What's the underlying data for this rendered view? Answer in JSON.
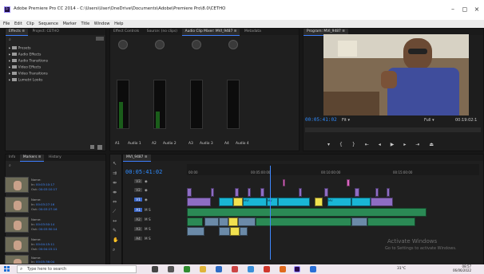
{
  "window": {
    "title": "Adobe Premiere Pro CC 2014 - C:\\Users\\User\\OneDrive\\Documents\\Adobe\\Premiere Pro\\8.0\\CETHO",
    "app_icon": "Pr",
    "minimize": "–",
    "maximize": "◻",
    "close": "×"
  },
  "menu": [
    "File",
    "Edit",
    "Clip",
    "Sequence",
    "Marker",
    "Title",
    "Window",
    "Help"
  ],
  "effects_panel": {
    "tabs": [
      "Effects ≡",
      "Project: CETHO"
    ],
    "items": [
      "Presets",
      "Audio Effects",
      "Audio Transitions",
      "Video Effects",
      "Video Transitions",
      "Lumetri Looks"
    ]
  },
  "mixer_panel": {
    "tabs": [
      "Effect Controls",
      "Source: (no clips)",
      "Audio Clip Mixer: MVI_9487 ≡",
      "Metadata"
    ],
    "tracks": [
      {
        "id": "A1",
        "name": "Audio 1",
        "level": 0.55
      },
      {
        "id": "A2",
        "name": "Audio 2",
        "level": 0.35
      },
      {
        "id": "A3",
        "name": "Audio 3",
        "level": 0.0
      },
      {
        "id": "A4",
        "name": "Audio 4",
        "level": 0.0
      }
    ],
    "scale": [
      "6",
      "-6",
      "-12",
      "-18",
      "-24",
      "-30",
      "-36",
      "-42",
      "-48",
      "dB"
    ]
  },
  "program_panel": {
    "tab": "Program: MVI_9487 ≡",
    "timecode": "00:05:41:02",
    "fit": "Fit",
    "quality": "Full",
    "duration": "00:19:02:1"
  },
  "project_panel": {
    "tabs": [
      "Info",
      "Markers ≡",
      "History"
    ],
    "clips": [
      {
        "name": "Name:",
        "in": "00:03:10:17",
        "out": "00:03:10:17"
      },
      {
        "name": "Name:",
        "in": "00:03:27:16",
        "out": "00:03:27:16"
      },
      {
        "name": "Name:",
        "in": "00:03:50:14",
        "out": "00:03:50:14"
      },
      {
        "name": "Name:",
        "in": "00:04:15:11",
        "out": "00:04:15:11"
      },
      {
        "name": "Name:",
        "in": "00:05:36:04",
        "out": "00:05:36:04"
      }
    ],
    "in_label": "In:",
    "out_label": "Out:"
  },
  "timeline": {
    "tab": "MVI_9487 ≡",
    "timecode": "00:05:41:02",
    "ruler": [
      "00:00",
      "00:05:00:00",
      "00:10:00:00",
      "00:15:00:00"
    ],
    "tracks": [
      "V3",
      "V2",
      "V1",
      "A1",
      "A2",
      "A3",
      "A4"
    ],
    "clip_labels": [
      "MVI",
      "MV",
      "MV"
    ]
  },
  "watermark": {
    "line1": "Activate Windows",
    "line2": "Go to Settings to activate Windows."
  },
  "taskbar": {
    "search_placeholder": "Type here to search",
    "weather": "31°C",
    "time": "08:57",
    "date": "06/06/2022"
  },
  "colors": {
    "accent": "#3f88ff",
    "clip_cyan": "#19b6d5",
    "clip_green": "#2b8a55",
    "clip_yellow": "#f1e14f",
    "clip_purple": "#8e6dc4",
    "clip_pink": "#d966c0",
    "clip_gray": "#6b8aa8"
  }
}
